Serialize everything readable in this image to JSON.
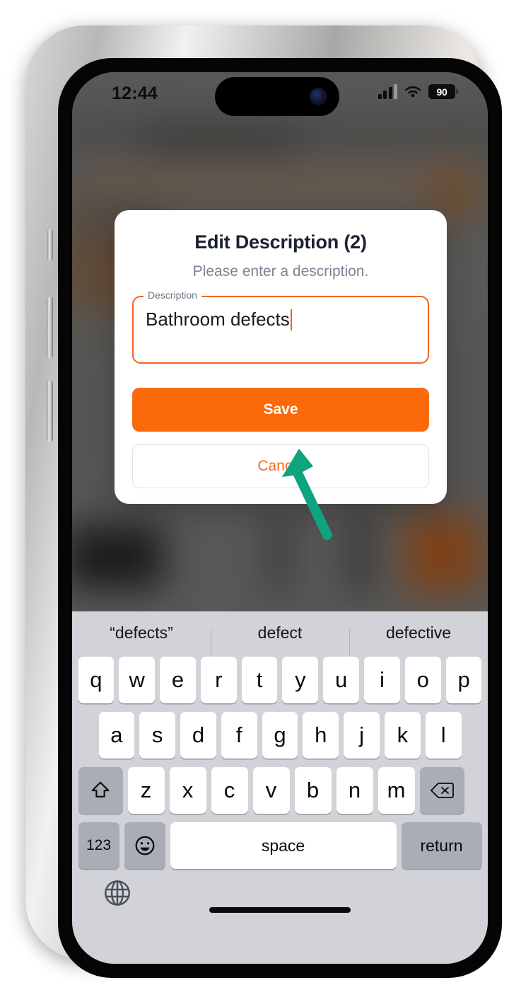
{
  "status_bar": {
    "time": "12:44",
    "battery_level": "90",
    "cellular_icon": "cellular-bars-icon",
    "wifi_icon": "wifi-icon",
    "battery_icon": "battery-icon"
  },
  "dialog": {
    "title": "Edit Description (2)",
    "subtitle": "Please enter a description.",
    "field": {
      "legend": "Description",
      "value": "Bathroom defects",
      "placeholder": "Please enter a description."
    },
    "save_label": "Save",
    "cancel_label": "Cancel",
    "accent_color": "#fa6a0a",
    "cancel_text_color": "#f4681f",
    "border_color": "#f0651f"
  },
  "cursor": {
    "color": "#0fa47f",
    "name": "pointer-arrow"
  },
  "keyboard": {
    "suggestions": [
      "“defects”",
      "defect",
      "defective"
    ],
    "row1": [
      "q",
      "w",
      "e",
      "r",
      "t",
      "y",
      "u",
      "i",
      "o",
      "p"
    ],
    "row2": [
      "a",
      "s",
      "d",
      "f",
      "g",
      "h",
      "j",
      "k",
      "l"
    ],
    "row3": [
      "z",
      "x",
      "c",
      "v",
      "b",
      "n",
      "m"
    ],
    "shift_label": "⇧",
    "backspace_label": "⌫",
    "numbers_label": "123",
    "emoji_label": "☺",
    "space_label": "space",
    "return_label": "return",
    "globe_label": "globe-icon"
  }
}
